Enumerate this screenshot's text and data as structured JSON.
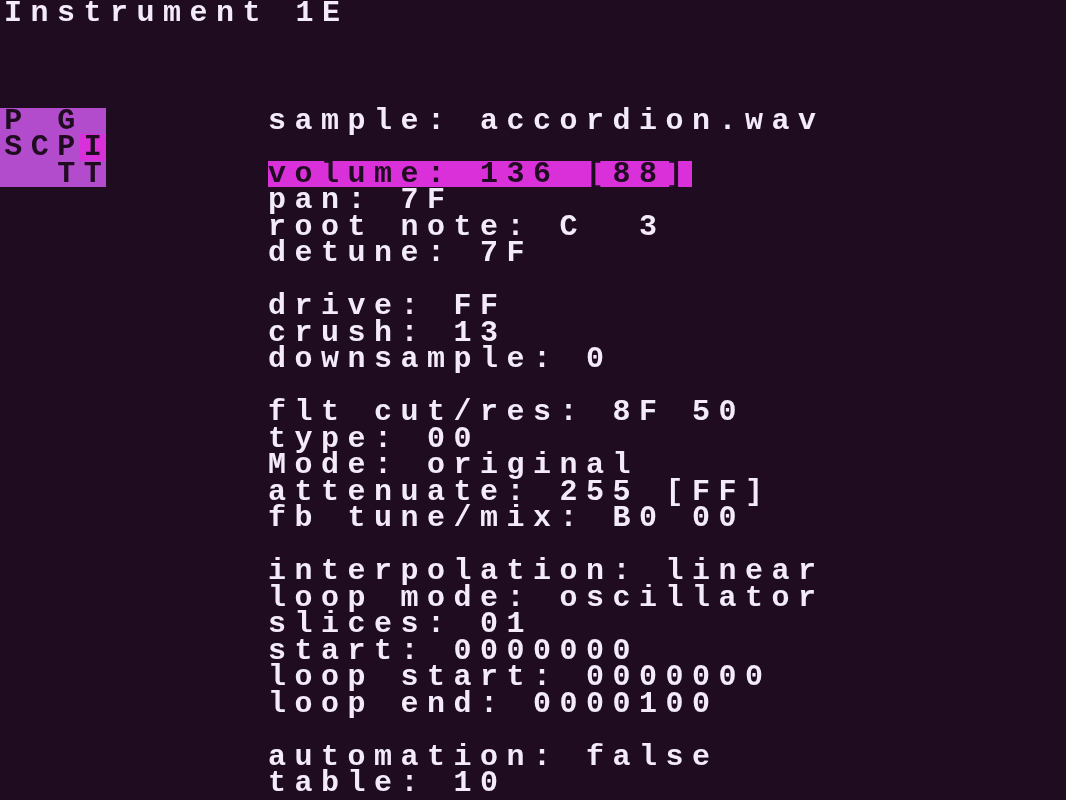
{
  "title": "Instrument 1E",
  "minimap": [
    [
      {
        "label": "P",
        "selected": false
      },
      {
        "kind": "blank"
      },
      {
        "label": "G",
        "selected": false
      },
      {
        "kind": "blank"
      }
    ],
    [
      {
        "label": "S",
        "selected": false
      },
      {
        "label": "C",
        "selected": false
      },
      {
        "label": "P",
        "selected": false
      },
      {
        "label": "I",
        "selected": true
      }
    ],
    [
      {
        "kind": "blank"
      },
      {
        "kind": "blank"
      },
      {
        "label": "T",
        "selected": false
      },
      {
        "label": "T",
        "selected": false
      }
    ]
  ],
  "sections": [
    [
      {
        "text": "sample: accordion.wav",
        "selected": false
      }
    ],
    [
      {
        "text": "volume: 136 [88]",
        "selected": true
      },
      {
        "text": "pan: 7F",
        "selected": false
      },
      {
        "text": "root note: C  3",
        "selected": false
      },
      {
        "text": "detune: 7F",
        "selected": false
      }
    ],
    [
      {
        "text": "drive: FF",
        "selected": false
      },
      {
        "text": "crush: 13",
        "selected": false
      },
      {
        "text": "downsample: 0",
        "selected": false
      }
    ],
    [
      {
        "text": "flt cut/res: 8F 50",
        "selected": false
      },
      {
        "text": "type: 00",
        "selected": false
      },
      {
        "text": "Mode: original",
        "selected": false
      },
      {
        "text": "attenuate: 255 [FF]",
        "selected": false
      },
      {
        "text": "fb tune/mix: B0 00",
        "selected": false
      }
    ],
    [
      {
        "text": "interpolation: linear",
        "selected": false
      },
      {
        "text": "loop mode: oscillator",
        "selected": false
      },
      {
        "text": "slices: 01",
        "selected": false
      },
      {
        "text": "start: 0000000",
        "selected": false
      },
      {
        "text": "loop start: 0000000",
        "selected": false
      },
      {
        "text": "loop end: 0000100",
        "selected": false
      }
    ],
    [
      {
        "text": "automation: false",
        "selected": false
      },
      {
        "text": "table: 10",
        "selected": false
      }
    ]
  ]
}
